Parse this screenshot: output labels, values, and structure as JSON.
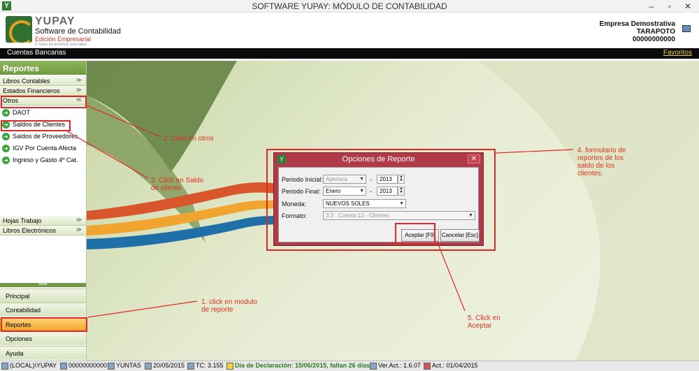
{
  "window": {
    "title": "SOFTWARE YUPAY: MÓDULO DE CONTABILIDAD",
    "minimize": "–",
    "maximize": "▫",
    "close": "✕"
  },
  "header": {
    "logo_name": "YUPAY",
    "logo_subtitle": "Software de Contabilidad",
    "logo_edition": "Edición Empresarial",
    "logo_tagline": "© Todos los derechos reservados",
    "company_name": "Empresa Demostrativa",
    "company_city": "TARAPOTO",
    "company_ruc": "00000000000"
  },
  "menubar": {
    "breadcrumb": "Cuentas Bancarias",
    "favorites": "Favoritos"
  },
  "sidebar": {
    "title": "Reportes",
    "sections": [
      {
        "label": "Libros Contables",
        "chevron": "≫"
      },
      {
        "label": "Estados Financieros",
        "chevron": "≫"
      },
      {
        "label": "Otros",
        "chevron": "≪"
      }
    ],
    "items": [
      {
        "label": "DAOT"
      },
      {
        "label": "Saldos de Clientes"
      },
      {
        "label": "Saldos de Proveedores"
      },
      {
        "label": "IGV Por Cuenta Afecta"
      },
      {
        "label": "Ingreso y Gasto 4º Cat."
      }
    ],
    "lower_sections": [
      {
        "label": "Hojas Trabajo",
        "chevron": "≫"
      },
      {
        "label": "Libros Electrónicos",
        "chevron": "≫"
      }
    ],
    "grip": "•••••",
    "nav": [
      {
        "label": "Principal"
      },
      {
        "label": "Contabilidad"
      },
      {
        "label": "Reportes"
      },
      {
        "label": "Opciones"
      },
      {
        "label": "Ayuda"
      }
    ]
  },
  "dialog": {
    "title": "Opciones de Reporte",
    "close": "✕",
    "periodo_inicial_label": "Periodo Inicial:",
    "periodo_inicial_value": "Apertura",
    "periodo_inicial_year": "2013",
    "periodo_final_label": "Periodo Final:",
    "periodo_final_value": "Enero",
    "periodo_final_year": "2013",
    "dash": "-",
    "moneda_label": "Moneda:",
    "moneda_value": "NUEVOS SOLES",
    "formato_label": "Formato:",
    "formato_value": "3.3  : Cuenta 12 - Clientes",
    "accept": "Aceptar [F9]",
    "cancel": "Cancelar [Esc]"
  },
  "annotations": {
    "step1": "1. click en modulo de reporte",
    "step1_l1": "1. click en modulo",
    "step1_l2": "de  reporte",
    "step2": "2. Click en otros",
    "step3_l1": "3. Click en Saldo",
    "step3_l2": "de cliente",
    "step4_l1": "4.   formulario de",
    "step4_l2": "reportes   de los",
    "step4_l3": "saldo de los",
    "step4_l4": "clientes.",
    "step5_l1": "5. Click en",
    "step5_l2": "Aceptar",
    "color": "#e52626"
  },
  "statusbar": {
    "server": "(LOCAL)\\YUPAY",
    "ruc": "00000000000",
    "user": "YUNTAS",
    "date": "20/05/2015",
    "tc": "TC: 3.155",
    "declaration": "Día de Declaración: 15/06/2015, faltan 26 días",
    "version": "Ver.Act.: 1.6.07",
    "updated": "Act.: 01/04/2015"
  }
}
